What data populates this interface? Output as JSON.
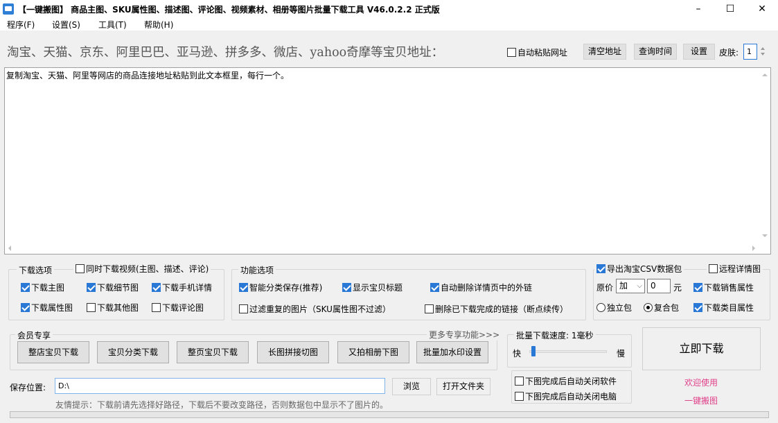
{
  "window": {
    "title": "【一键搬图】 商品主图、SKU属性图、描述图、评论图、视频素材、相册等图片批量下载工具 V46.0.2.2 正式版",
    "minimize": "–",
    "maximize": "☐",
    "close": "✕"
  },
  "menu": [
    "程序(F)",
    "设置(S)",
    "工具(T)",
    "帮助(H)"
  ],
  "top": {
    "label": "淘宝、天猫、京东、阿里巴巴、亚马逊、拼多多、微店、yahoo奇摩等宝贝地址：",
    "auto_paste": "自动粘贴网址",
    "clear_btn": "清空地址",
    "query_btn": "查询时间",
    "settings_btn": "设置",
    "skin_label": "皮肤:",
    "skin_value": "1"
  },
  "textarea": {
    "content": "复制淘宝、天猫、阿里等网店的商品连接地址粘贴到此文本框里，每行一个。"
  },
  "download_options": {
    "legend": "下载选项",
    "video": "同时下载视频(主图、描述、评论)",
    "main_img": "下载主图",
    "detail_img": "下载细节图",
    "mobile_detail": "下载手机详情",
    "attr_img": "下载属性图",
    "other_img": "下载其他图",
    "comment_img": "下载评论图"
  },
  "function_options": {
    "legend": "功能选项",
    "smart_sort": "智能分类保存(推荐)",
    "show_title": "显示宝贝标题",
    "auto_delete_links": "自动删除详情页中的外链",
    "filter_dup": "过滤重复的图片（SKU属性图不过滤）",
    "delete_done": "删除已下载完成的链接（断点续传）"
  },
  "right_options": {
    "export_csv": "导出淘宝CSV数据包",
    "remote_detail": "远程详情图",
    "price_label": "原价",
    "price_op": "加",
    "price_value": "0",
    "price_unit": "元",
    "sales_attr": "下载销售属性",
    "standalone": "独立包",
    "combined": "复合包",
    "category_attr": "下载类目属性"
  },
  "member": {
    "legend": "会员专享",
    "more": "更多专享功能>>>",
    "buttons": [
      "整店宝贝下载",
      "宝贝分类下载",
      "整页宝贝下载",
      "长图拼接切图",
      "又拍相册下图",
      "批量加水印设置"
    ]
  },
  "speed": {
    "legend": "批量下载速度: 1毫秒",
    "fast": "快",
    "slow": "慢",
    "slider_value": 0.05
  },
  "download_btn": "立即下载",
  "after": {
    "close_app": "下图完成后自动关闭软件",
    "shutdown": "下图完成后自动关闭电脑"
  },
  "welcome": {
    "line1": "欢迎使用",
    "line2": "一键搬图"
  },
  "save": {
    "label": "保存位置:",
    "path": "D:\\",
    "browse": "浏览",
    "open_folder": "打开文件夹",
    "tip": "友情提示：下载前请先选择好路径，下载后不要改变路径，否则数据包中显示不了图片的。"
  },
  "colors": {
    "accent": "#2a78d6",
    "pink": "#e0408a"
  }
}
